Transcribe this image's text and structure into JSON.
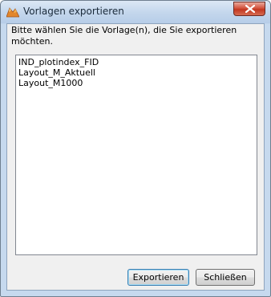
{
  "window": {
    "title": "Vorlagen exportieren"
  },
  "dialog": {
    "instruction": "Bitte wählen Sie die Vorlage(n), die Sie exportieren möchten.",
    "templates": [
      "IND_plotindex_FID",
      "Layout_M_Aktuell",
      "Layout_M1000"
    ]
  },
  "buttons": {
    "export_label": "Exportieren",
    "close_label": "Schließen"
  },
  "icons": {
    "app": "map-icon",
    "close": "close-icon"
  },
  "colors": {
    "close_button": "#c2361f",
    "default_button_border": "#3c7fb1"
  }
}
